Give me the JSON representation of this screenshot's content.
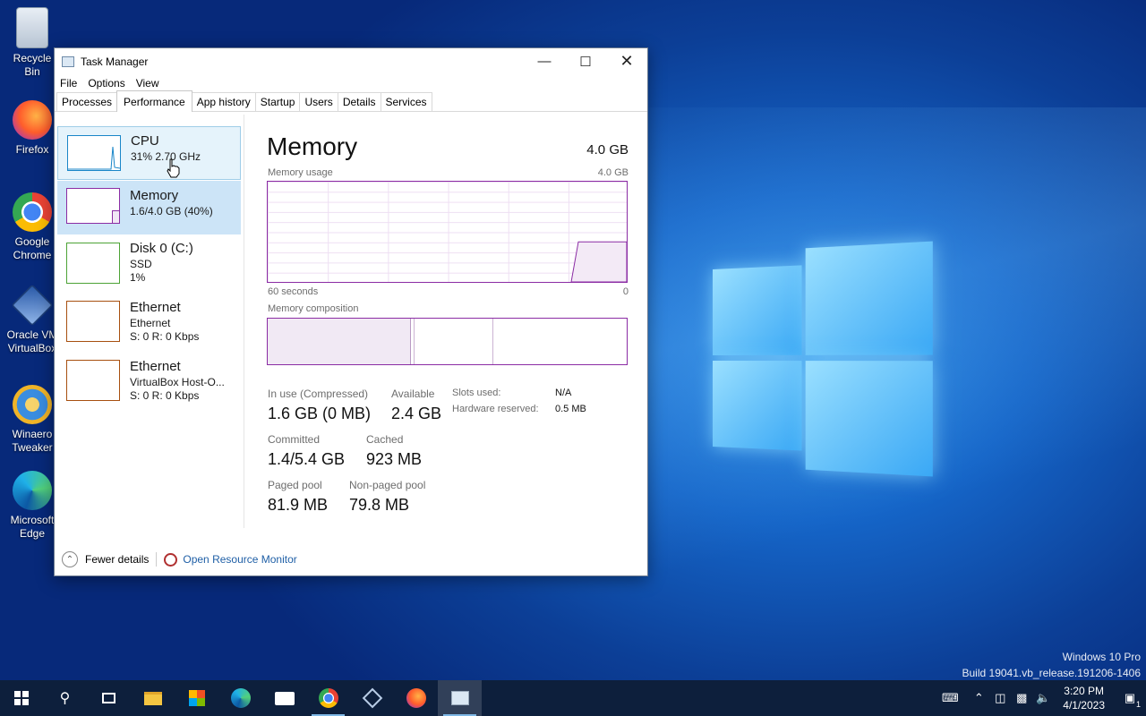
{
  "desktop": {
    "icons": [
      {
        "label": "Recycle Bin"
      },
      {
        "label": "Firefox"
      },
      {
        "label": "Google Chrome"
      },
      {
        "label": "Oracle VM VirtualBox"
      },
      {
        "label": "Winaero Tweaker"
      },
      {
        "label": "Microsoft Edge"
      }
    ],
    "watermark": {
      "line1": "Windows 10 Pro",
      "line2": "Build 19041.vb_release.191206-1406"
    }
  },
  "window": {
    "title": "Task Manager",
    "menu": [
      "File",
      "Options",
      "View"
    ],
    "tabs": [
      "Processes",
      "Performance",
      "App history",
      "Startup",
      "Users",
      "Details",
      "Services"
    ],
    "active_tab": "Performance"
  },
  "sidebar": {
    "items": [
      {
        "title": "CPU",
        "line1": "31% 2.70 GHz",
        "line2": "",
        "color": "#1a86c8"
      },
      {
        "title": "Memory",
        "line1": "1.6/4.0 GB (40%)",
        "line2": "",
        "color": "#8b2ca4"
      },
      {
        "title": "Disk 0 (C:)",
        "line1": "SSD",
        "line2": "1%",
        "color": "#4da336"
      },
      {
        "title": "Ethernet",
        "line1": "Ethernet",
        "line2": "S: 0 R: 0 Kbps",
        "color": "#a74f0f"
      },
      {
        "title": "Ethernet",
        "line1": "VirtualBox Host-O...",
        "line2": "S: 0 R: 0 Kbps",
        "color": "#a74f0f"
      }
    ]
  },
  "memory": {
    "title": "Memory",
    "capacity": "4.0 GB",
    "usage_label": "Memory usage",
    "usage_max": "4.0 GB",
    "usage_fraction_now": 0.4,
    "time_left": "60 seconds",
    "time_right": "0",
    "composition_label": "Memory composition",
    "composition_fractions": {
      "in_use": 0.4,
      "modified": 0.01,
      "standby": 0.22
    },
    "stats": {
      "in_use_label": "In use (Compressed)",
      "in_use_value": "1.6 GB (0 MB)",
      "available_label": "Available",
      "available_value": "2.4 GB",
      "committed_label": "Committed",
      "committed_value": "1.4/5.4 GB",
      "cached_label": "Cached",
      "cached_value": "923 MB",
      "paged_label": "Paged pool",
      "paged_value": "81.9 MB",
      "nonpaged_label": "Non-paged pool",
      "nonpaged_value": "79.8 MB",
      "slots_label": "Slots used:",
      "slots_value": "N/A",
      "hwres_label": "Hardware reserved:",
      "hwres_value": "0.5 MB"
    }
  },
  "footer": {
    "fewer_details": "Fewer details",
    "resource_monitor": "Open Resource Monitor"
  },
  "taskbar": {
    "time": "3:20 PM",
    "date": "4/1/2023",
    "notification_count": "1"
  }
}
